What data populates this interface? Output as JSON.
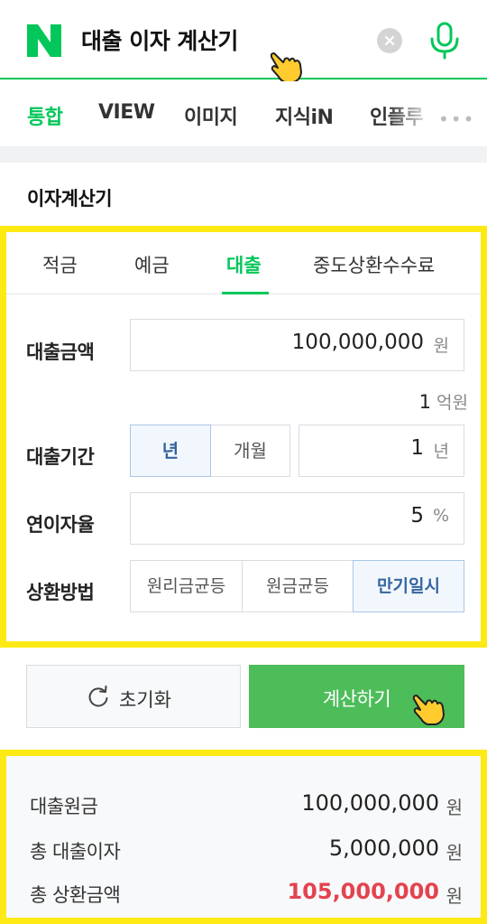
{
  "search": {
    "query": "대출 이자 계산기"
  },
  "tabs": [
    {
      "label": "통합",
      "active": true
    },
    {
      "label": "VIEW",
      "active": false
    },
    {
      "label": "이미지",
      "active": false
    },
    {
      "label": "지식iN",
      "active": false
    },
    {
      "label": "인플루",
      "active": false
    }
  ],
  "section_title": "이자계산기",
  "calculator": {
    "tabs": [
      "적금",
      "예금",
      "대출",
      "중도상환수수료"
    ],
    "active_tab": "대출",
    "loan_amount": {
      "label": "대출금액",
      "value": "100,000,000",
      "unit": "원",
      "hint_value": "1",
      "hint_unit": "억원"
    },
    "loan_period": {
      "label": "대출기간",
      "unit_options": [
        "년",
        "개월"
      ],
      "selected_unit": "년",
      "value": "1",
      "unit": "년"
    },
    "interest_rate": {
      "label": "연이자율",
      "value": "5",
      "unit": "%"
    },
    "repayment": {
      "label": "상환방법",
      "options": [
        "원리금균등",
        "원금균등",
        "만기일시"
      ],
      "selected": "만기일시"
    }
  },
  "buttons": {
    "reset_label": "초기화",
    "calculate_label": "계산하기"
  },
  "results": {
    "principal": {
      "label": "대출원금",
      "value": "100,000,000",
      "unit": "원"
    },
    "total_interest": {
      "label": "총 대출이자",
      "value": "5,000,000",
      "unit": "원"
    },
    "total_repayment": {
      "label": "총 상환금액",
      "value": "105,000,000",
      "unit": "원"
    }
  },
  "colors": {
    "naver_green": "#03c75a",
    "button_green": "#4dbd5a",
    "highlight_yellow": "#fdea14",
    "total_red": "#e3434f",
    "selected_blue": "#36659f"
  }
}
